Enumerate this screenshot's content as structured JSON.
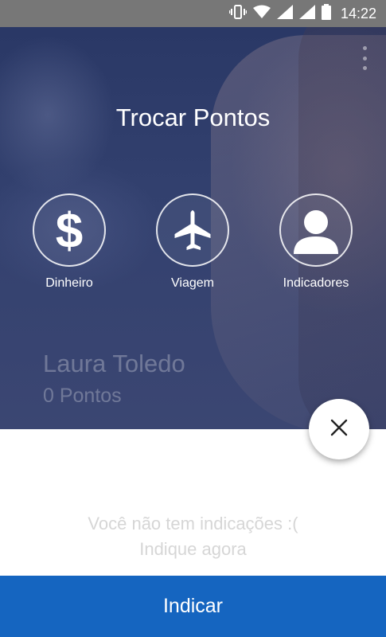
{
  "status_bar": {
    "time": "14:22",
    "icons": [
      "vibrate-icon",
      "wifi-icon",
      "signal-icon",
      "signal-icon",
      "battery-icon"
    ]
  },
  "hero": {
    "title": "Trocar Pontos",
    "options": [
      {
        "label": "Dinheiro",
        "icon": "dollar-icon"
      },
      {
        "label": "Viagem",
        "icon": "airplane-icon"
      },
      {
        "label": "Indicadores",
        "icon": "person-icon"
      }
    ],
    "user": {
      "name": "Laura Toledo",
      "points": "0 Pontos"
    }
  },
  "empty_state": {
    "line1": "Você não tem indicações :(",
    "line2": "Indique agora"
  },
  "cta": {
    "label": "Indicar"
  },
  "colors": {
    "accent": "#1565c0",
    "hero_bg": "#33416f",
    "status_bar": "#777777"
  }
}
